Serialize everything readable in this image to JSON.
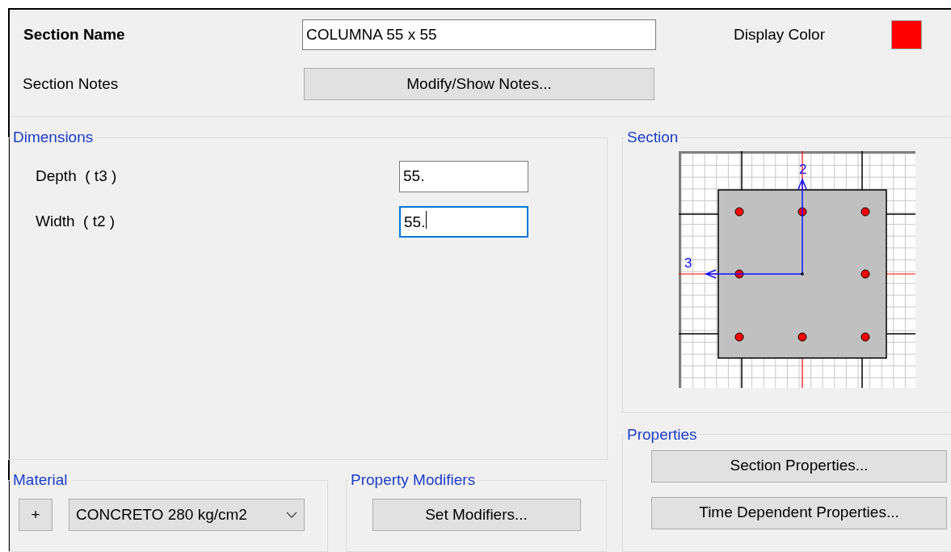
{
  "section_name": {
    "label": "Section Name",
    "value": "COLUMNA 55 x 55"
  },
  "display_color": {
    "label": "Display Color",
    "color": "#ff0000"
  },
  "section_notes": {
    "label": "Section Notes",
    "button": "Modify/Show Notes..."
  },
  "dimensions": {
    "title": "Dimensions",
    "fields": [
      {
        "label": "Depth  ( t3 )",
        "value": "55.",
        "focused": false
      },
      {
        "label": "Width  ( t2 )",
        "value": "55.",
        "focused": true
      }
    ]
  },
  "section": {
    "title": "Section",
    "axis_labels": [
      "2",
      "3"
    ]
  },
  "properties": {
    "title": "Properties",
    "buttons": [
      "Section Properties...",
      "Time Dependent Properties..."
    ]
  },
  "material": {
    "title": "Material",
    "add_button": "+",
    "value": "CONCRETO 280 kg/cm2"
  },
  "property_modifiers": {
    "title": "Property Modifiers",
    "button": "Set Modifiers..."
  }
}
